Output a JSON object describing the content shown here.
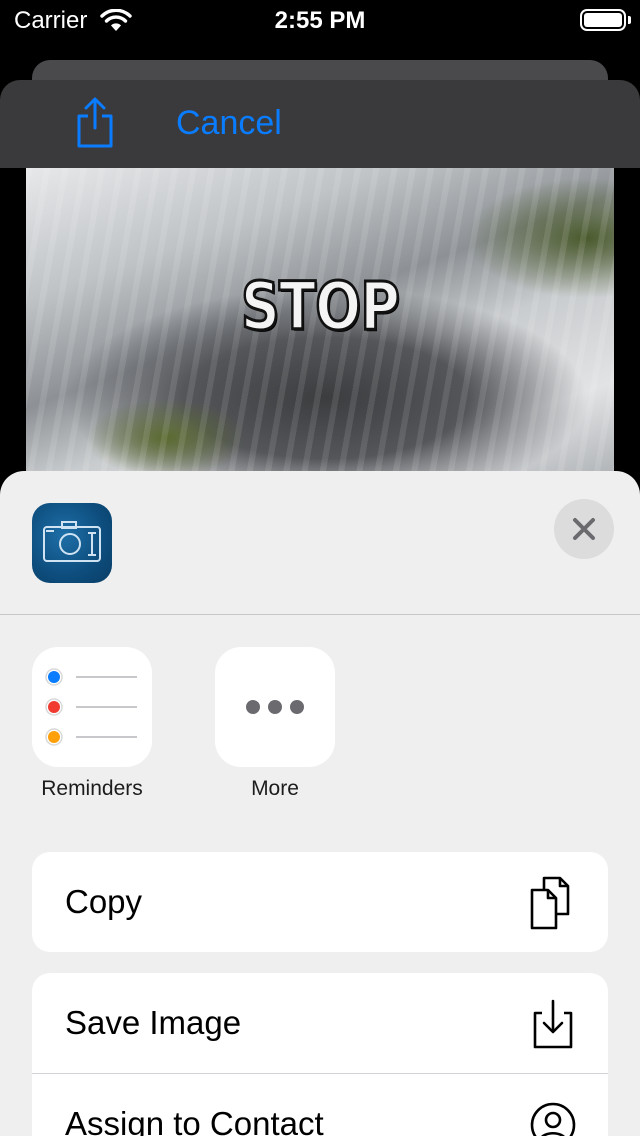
{
  "status_bar": {
    "carrier": "Carrier",
    "time": "2:55 PM"
  },
  "toolbar": {
    "cancel_label": "Cancel",
    "share_icon": "share-icon",
    "accent_color": "#0a7cff"
  },
  "image": {
    "overlay_text": "STOP"
  },
  "share_sheet": {
    "app_icon": "camera-app-icon",
    "close_icon": "close-icon",
    "apps": [
      {
        "label": "Reminders",
        "icon": "reminders-icon"
      },
      {
        "label": "More",
        "icon": "more-icon"
      }
    ],
    "actions": [
      {
        "label": "Copy",
        "icon": "copy-icon"
      },
      {
        "label": "Save Image",
        "icon": "save-image-icon"
      },
      {
        "label": "Assign to Contact",
        "icon": "contact-icon"
      }
    ]
  }
}
